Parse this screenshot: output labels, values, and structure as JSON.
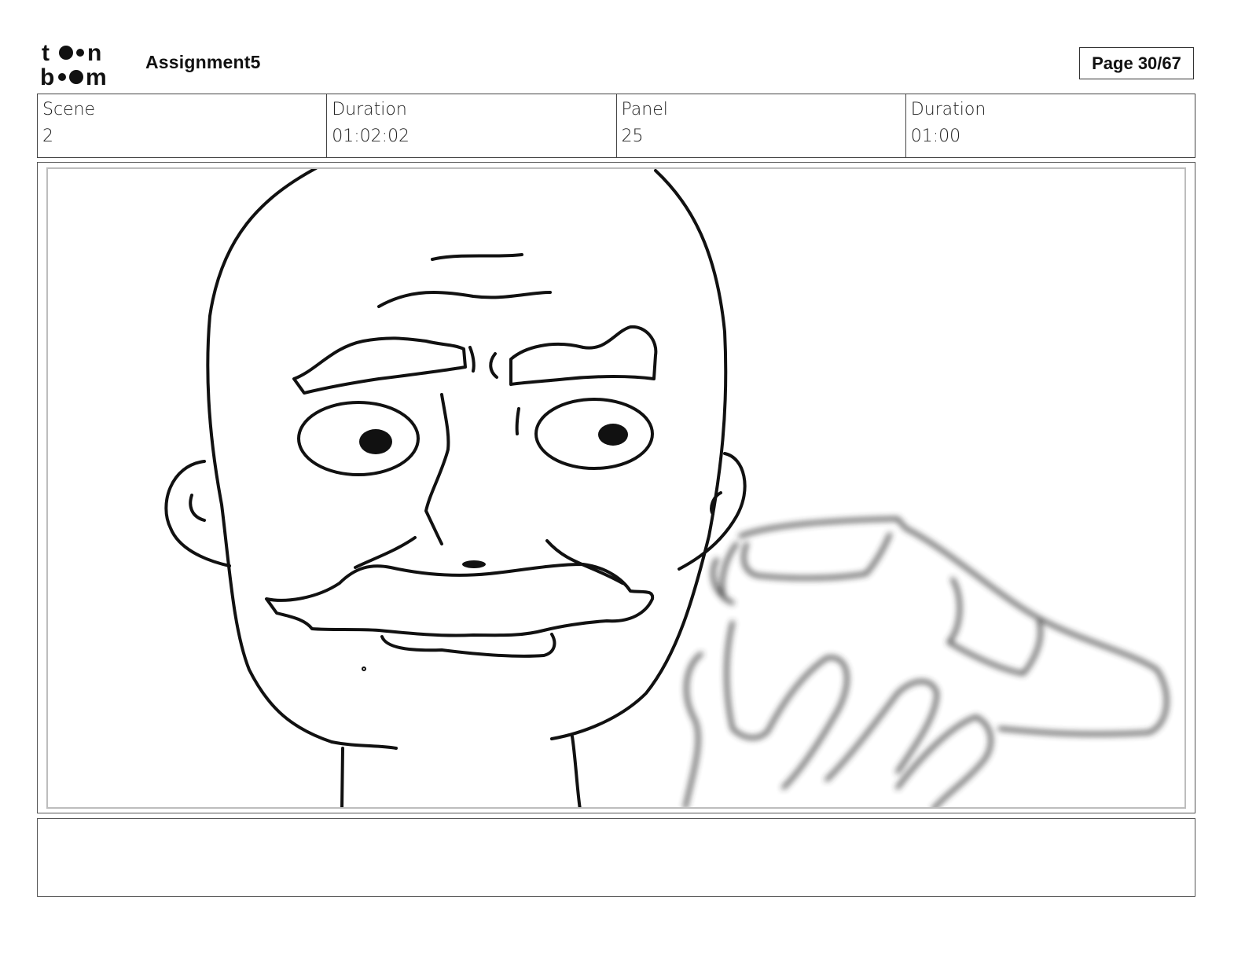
{
  "header": {
    "logo_text": "toon boom",
    "project_title": "Assignment5",
    "page_label": "Page 30/67"
  },
  "info": {
    "scene_label": "Scene",
    "scene_value": "2",
    "scene_duration_label": "Duration",
    "scene_duration_value": "01:02:02",
    "panel_label": "Panel",
    "panel_value": "25",
    "panel_duration_label": "Duration",
    "panel_duration_value": "01:00"
  },
  "panel": {
    "drawing_icon": "sketch-face-with-blurred-hand"
  },
  "notes": {
    "text": ""
  }
}
